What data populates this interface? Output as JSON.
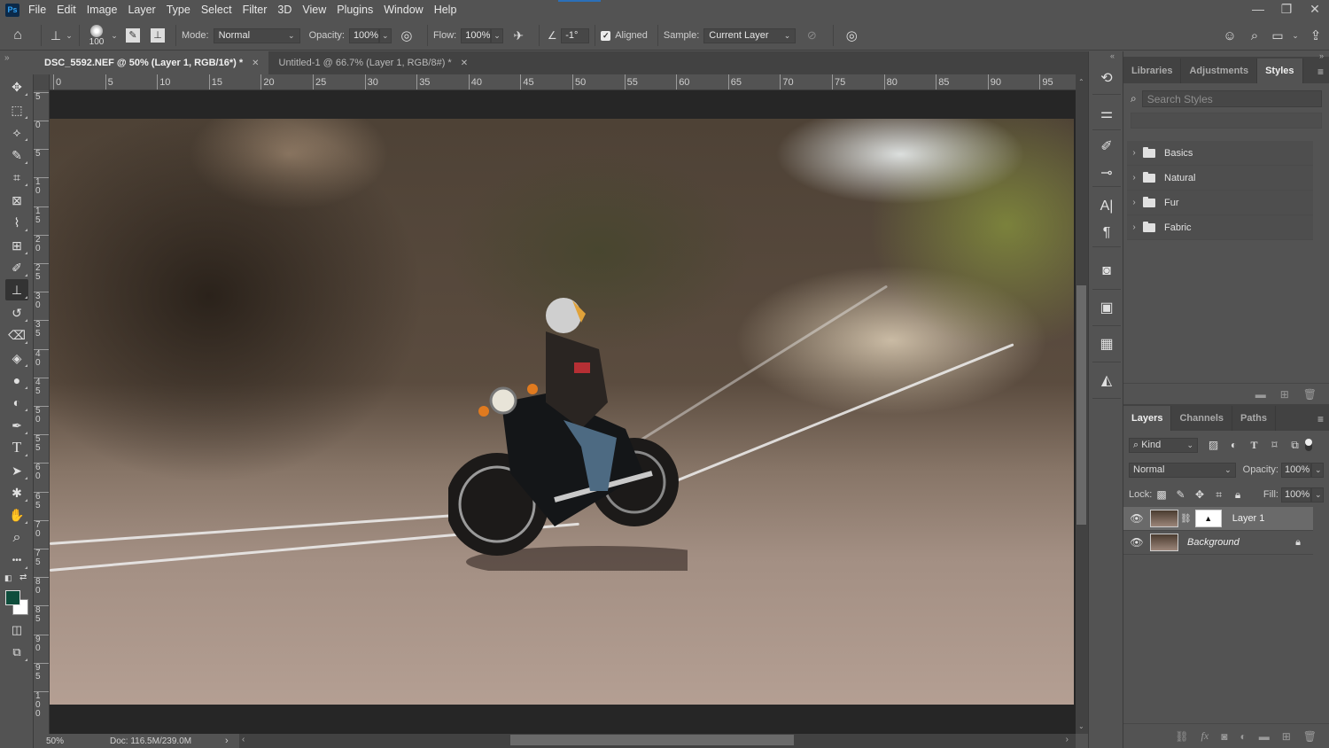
{
  "app": {
    "logo": "Ps"
  },
  "menu": [
    "File",
    "Edit",
    "Image",
    "Layer",
    "Type",
    "Select",
    "Filter",
    "3D",
    "View",
    "Plugins",
    "Window",
    "Help"
  ],
  "window_controls": {
    "minimize": "—",
    "restore": "❐",
    "close": "✕"
  },
  "options_bar": {
    "brush_size": "100",
    "mode_label": "Mode:",
    "mode_value": "Normal",
    "opacity_label": "Opacity:",
    "opacity_value": "100%",
    "flow_label": "Flow:",
    "flow_value": "100%",
    "angle_value": "-1°",
    "aligned_label": "Aligned",
    "aligned_checked": true,
    "sample_label": "Sample:",
    "sample_value": "Current Layer"
  },
  "doc_tabs": [
    {
      "label": "DSC_5592.NEF @ 50% (Layer 1, RGB/16*) *",
      "active": true
    },
    {
      "label": "Untitled-1 @ 66.7% (Layer 1, RGB/8#) *",
      "active": false
    }
  ],
  "ruler_h": [
    "0",
    "5",
    "10",
    "15",
    "20",
    "25",
    "30",
    "35",
    "40",
    "45",
    "50",
    "55",
    "60",
    "65",
    "70",
    "75",
    "80",
    "85",
    "90",
    "95"
  ],
  "ruler_v": [
    "5",
    "0",
    "5",
    "1\n0",
    "1\n5",
    "2\n0",
    "2\n5",
    "3\n0",
    "3\n5",
    "4\n0",
    "4\n5",
    "5\n0",
    "5\n5",
    "6\n0",
    "6\n5",
    "7\n0",
    "7\n5",
    "8\n0",
    "8\n5",
    "9\n0",
    "9\n5",
    "1\n0\n0"
  ],
  "tools": [
    {
      "name": "move-tool",
      "glyph": "✥"
    },
    {
      "name": "marquee-tool",
      "glyph": "⬚"
    },
    {
      "name": "lasso-tool",
      "glyph": "⟡"
    },
    {
      "name": "quick-selection-tool",
      "glyph": "✎"
    },
    {
      "name": "crop-tool",
      "glyph": "⌗"
    },
    {
      "name": "frame-tool",
      "glyph": "⊠"
    },
    {
      "name": "eyedropper-tool",
      "glyph": "⌇"
    },
    {
      "name": "spot-healing-tool",
      "glyph": "⊞"
    },
    {
      "name": "brush-tool",
      "glyph": "✐"
    },
    {
      "name": "clone-stamp-tool",
      "glyph": "⊥"
    },
    {
      "name": "history-brush-tool",
      "glyph": "↺"
    },
    {
      "name": "eraser-tool",
      "glyph": "⌫"
    },
    {
      "name": "paint-bucket-tool",
      "glyph": "◈"
    },
    {
      "name": "blur-tool",
      "glyph": "●"
    },
    {
      "name": "dodge-tool",
      "glyph": "◐"
    },
    {
      "name": "pen-tool",
      "glyph": "✒"
    },
    {
      "name": "type-tool",
      "glyph": "T"
    },
    {
      "name": "path-selection-tool",
      "glyph": "➤"
    },
    {
      "name": "custom-shape-tool",
      "glyph": "✱"
    },
    {
      "name": "hand-tool",
      "glyph": "✋"
    },
    {
      "name": "zoom-tool",
      "glyph": "⌕"
    },
    {
      "name": "more-tools",
      "glyph": "•••"
    }
  ],
  "active_tool": "clone-stamp-tool",
  "colors": {
    "foreground": "#0f4d3c",
    "background": "#ffffff",
    "accent": "#2b6fb8"
  },
  "status": {
    "zoom": "50%",
    "doc": "Doc: 116.5M/239.0M"
  },
  "styles_panel": {
    "tabs": [
      "Libraries",
      "Adjustments",
      "Styles"
    ],
    "active_tab": "Styles",
    "search_placeholder": "Search Styles",
    "folders": [
      "Basics",
      "Natural",
      "Fur",
      "Fabric"
    ]
  },
  "layers_panel": {
    "tabs": [
      "Layers",
      "Channels",
      "Paths"
    ],
    "active_tab": "Layers",
    "kind_label": "Kind",
    "blend_mode": "Normal",
    "opacity_label": "Opacity:",
    "opacity_value": "100%",
    "lock_label": "Lock:",
    "fill_label": "Fill:",
    "fill_value": "100%",
    "layers": [
      {
        "name": "Layer 1",
        "selected": true,
        "has_mask": true,
        "locked": false
      },
      {
        "name": "Background",
        "selected": false,
        "has_mask": false,
        "locked": true
      }
    ]
  }
}
